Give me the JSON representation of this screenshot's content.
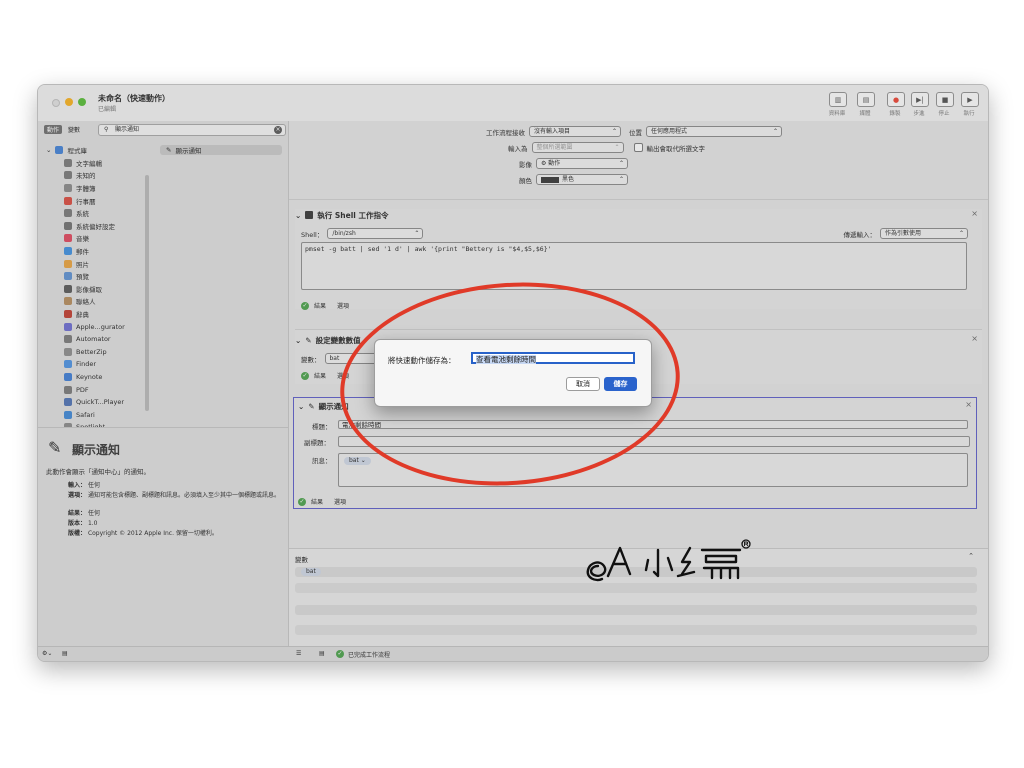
{
  "window": {
    "title": "未命名（快速動作）",
    "subtitle": "已編輯",
    "toolbar": [
      {
        "label": "資料庫",
        "icon": "sidebar-icon"
      },
      {
        "label": "媒體",
        "icon": "media-icon"
      },
      {
        "label": "錄製",
        "icon": "record-icon"
      },
      {
        "label": "步進",
        "icon": "step-icon"
      },
      {
        "label": "停止",
        "icon": "stop-icon"
      },
      {
        "label": "執行",
        "icon": "run-icon"
      }
    ]
  },
  "left": {
    "seg_actions": "動作",
    "seg_variables": "變數",
    "search_value": "顯示通知",
    "library": [
      {
        "label": "程式庫",
        "color": "#3f7fd6",
        "expanded": true
      },
      {
        "label": "文字編輯",
        "color": "#777777"
      },
      {
        "label": "未知的",
        "color": "#777777"
      },
      {
        "label": "字體簿",
        "color": "#888888"
      },
      {
        "label": "行事曆",
        "color": "#d9473b"
      },
      {
        "label": "系統",
        "color": "#777777"
      },
      {
        "label": "系統偏好設定",
        "color": "#6e6e6e"
      },
      {
        "label": "音樂",
        "color": "#e0435a"
      },
      {
        "label": "郵件",
        "color": "#3b8ee0"
      },
      {
        "label": "照片",
        "color": "#e9a23b"
      },
      {
        "label": "預覽",
        "color": "#5b8fd1"
      },
      {
        "label": "影像擷取",
        "color": "#555555"
      },
      {
        "label": "聯絡人",
        "color": "#b48a5a"
      },
      {
        "label": "辭典",
        "color": "#c0392b"
      },
      {
        "label": "Apple...gurator",
        "color": "#6a6ad0"
      },
      {
        "label": "Automator",
        "color": "#777777"
      },
      {
        "label": "BetterZip",
        "color": "#8a8a8a"
      },
      {
        "label": "Finder",
        "color": "#4a90e2"
      },
      {
        "label": "Keynote",
        "color": "#3a7bd5"
      },
      {
        "label": "PDF",
        "color": "#777777"
      },
      {
        "label": "QuickT...Player",
        "color": "#4b6fb3"
      },
      {
        "label": "Safari",
        "color": "#3b86d6"
      },
      {
        "label": "Spotlight",
        "color": "#888888"
      }
    ],
    "actions": [
      "顯示通知"
    ],
    "description": {
      "title": "顯示通知",
      "summary": "此動作會顯示「通知中心」的通知。",
      "rows": [
        {
          "k": "輸入：",
          "v": "任何"
        },
        {
          "k": "選項：",
          "v": "通知可能包含標題、副標題和訊息。必須填入至少其中一個標題或訊息。"
        },
        {
          "k": "結果：",
          "v": "任何"
        },
        {
          "k": "版本：",
          "v": "1.0"
        },
        {
          "k": "版權：",
          "v": "Copyright © 2012 Apple Inc. 保留一切權利。"
        }
      ]
    }
  },
  "workflow": {
    "receives_label": "工作流程接收",
    "receives_value": "沒有輸入項目",
    "location_label": "位置",
    "location_value": "任何應用程式",
    "input_label": "輸入為",
    "input_value": "整個所選範圍",
    "replace_label": "輸出會取代所選文字",
    "image_label": "影像",
    "image_value": "⚙ 動作",
    "color_label": "顏色",
    "color_value": "黑色",
    "color_swatch": "#333333"
  },
  "shell_action": {
    "title": "執行 Shell 工作指令",
    "shell_label": "Shell：",
    "shell_value": "/bin/zsh",
    "pass_label": "傳遞輸入：",
    "pass_value": "作為引數使用",
    "script": "pmset -g batt | sed '1 d' | awk '{print \"Bettery is \"$4,$5,$6}'",
    "results": "結果",
    "options": "選項"
  },
  "setvar_action": {
    "title": "設定變數數值",
    "var_label": "變數：",
    "var_value": "bat",
    "results": "結果",
    "options": "選項"
  },
  "notify_action": {
    "title": "顯示通知",
    "title_label": "標題：",
    "title_value": "電池剩餘時間",
    "subtitle_label": "副標題：",
    "message_label": "訊息：",
    "message_token": "bat ⌄",
    "results": "結果",
    "options": "選項"
  },
  "variables": {
    "header": "變數",
    "items": [
      "bat"
    ]
  },
  "status": {
    "text": "已完成工作流程"
  },
  "dialog": {
    "label": "將快速動作儲存為：",
    "value": "查看電池剩餘時間",
    "cancel": "取消",
    "save": "儲存"
  },
  "colors": {
    "accent": "#2a63cc",
    "annotation": "#e03a28"
  },
  "watermark_text": "A 小編"
}
